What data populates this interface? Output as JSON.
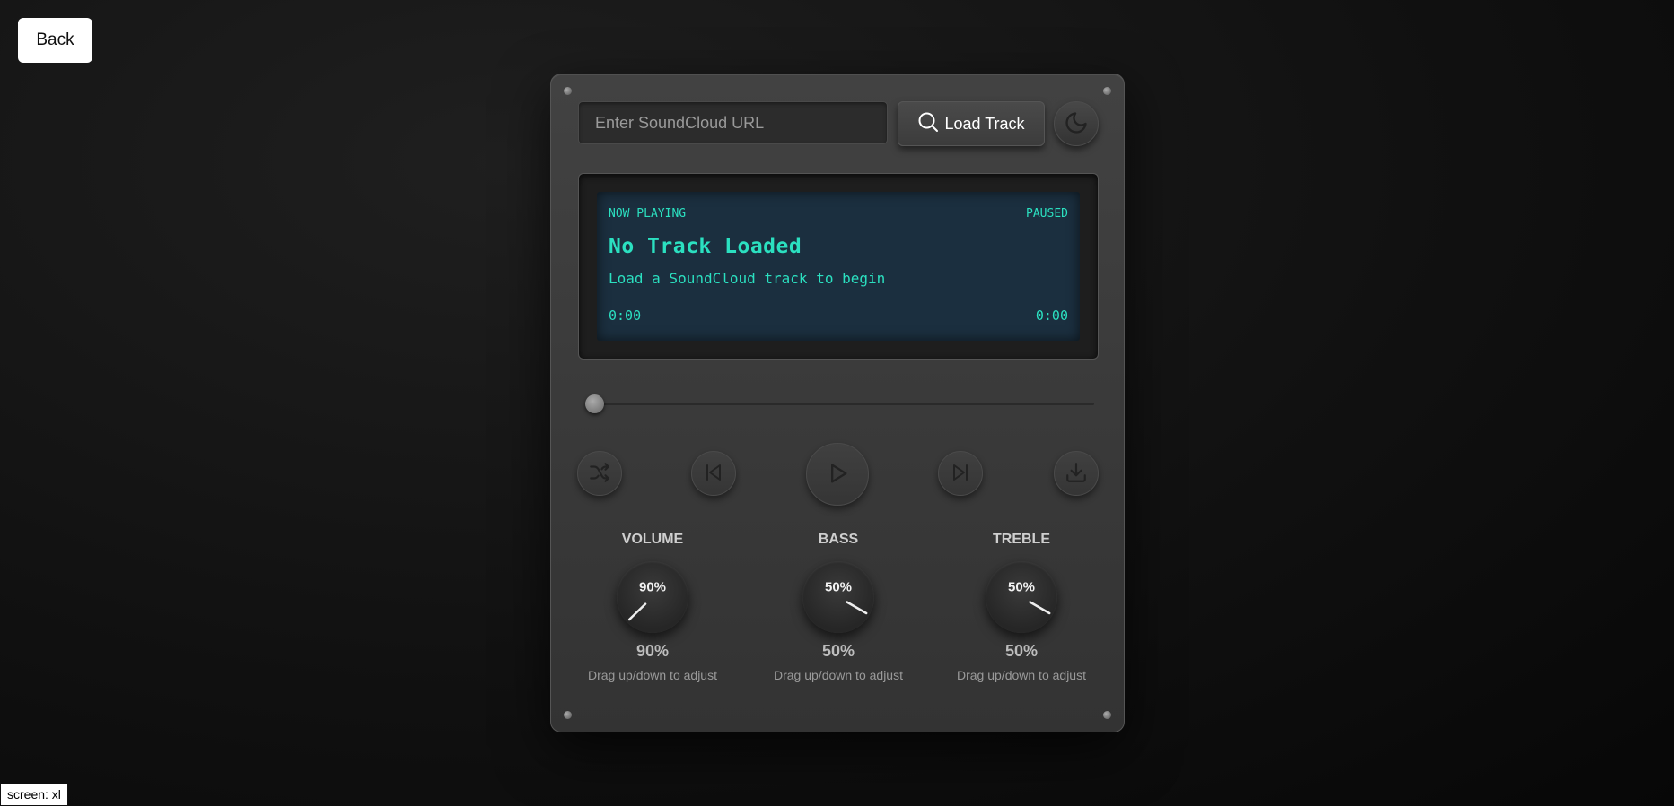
{
  "nav": {
    "back_label": "Back"
  },
  "search": {
    "placeholder": "Enter SoundCloud URL",
    "load_label": "Load Track"
  },
  "display": {
    "now_playing_label": "NOW PLAYING",
    "status": "PAUSED",
    "track_title": "No Track Loaded",
    "track_subtitle": "Load a SoundCloud track to begin",
    "current_time": "0:00",
    "duration": "0:00"
  },
  "playback": {
    "progress": 0
  },
  "knobs": [
    {
      "label": "VOLUME",
      "value": "90%",
      "level": 0.9,
      "hint": "Drag up/down to adjust"
    },
    {
      "label": "BASS",
      "value": "50%",
      "level": 0.5,
      "hint": "Drag up/down to adjust"
    },
    {
      "label": "TREBLE",
      "value": "50%",
      "level": 0.5,
      "hint": "Drag up/down to adjust"
    }
  ],
  "colors": {
    "lcd_text": "#2be0c0",
    "lcd_bg": "#1b2f3f"
  },
  "footer": {
    "screen_tag": "screen: xl"
  }
}
